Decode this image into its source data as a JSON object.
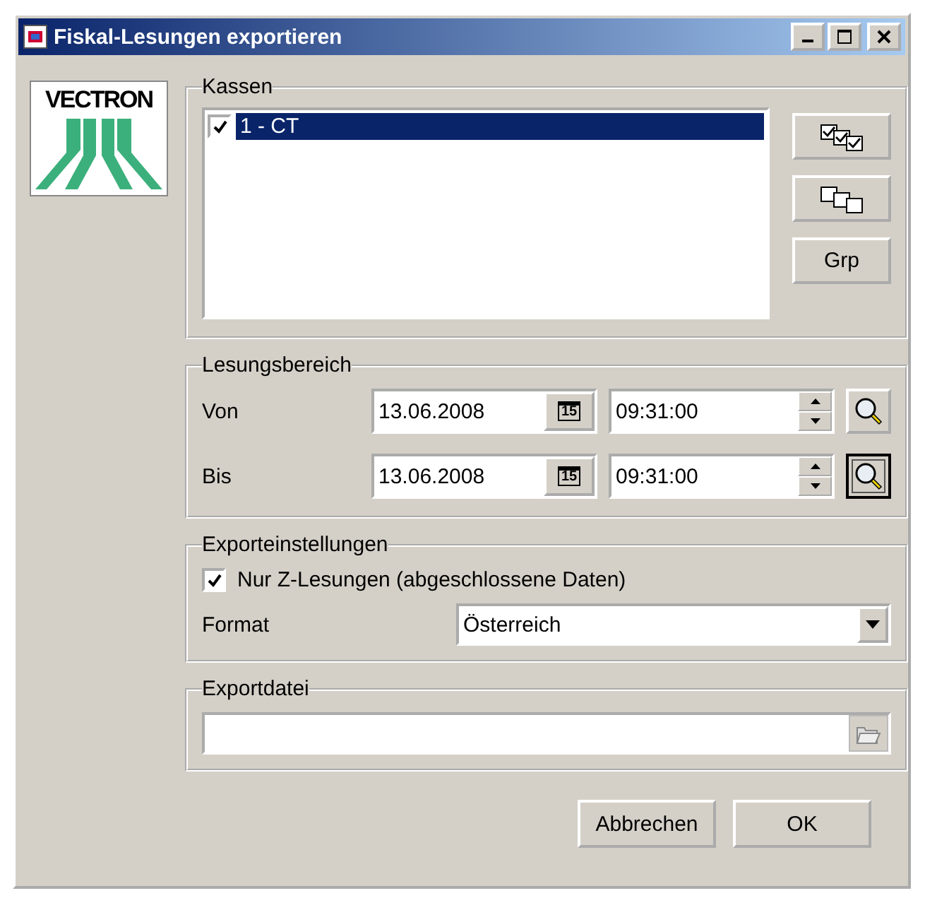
{
  "window": {
    "title": "Fiskal-Lesungen exportieren"
  },
  "logo": {
    "text": "VECTRON"
  },
  "kassen": {
    "label": "Kassen",
    "items": [
      {
        "label": "1 - CT",
        "checked": true,
        "selected": true
      }
    ],
    "buttons": [
      {
        "kind": "check-all"
      },
      {
        "kind": "uncheck-all"
      },
      {
        "kind": "text",
        "label": "Grp"
      }
    ]
  },
  "range": {
    "label": "Lesungsbereich",
    "rows": [
      {
        "label": "Von",
        "date": "13.06.2008",
        "calendar": "15",
        "time": "09:31:00",
        "focused": false
      },
      {
        "label": "Bis",
        "date": "13.06.2008",
        "calendar": "15",
        "time": "09:31:00",
        "focused": true
      }
    ]
  },
  "settings": {
    "label": "Exporteinstellungen",
    "only_z": {
      "label": "Nur Z-Lesungen (abgeschlossene Daten)",
      "checked": true
    },
    "format": {
      "label": "Format",
      "value": "Österreich"
    }
  },
  "export_file": {
    "label": "Exportdatei"
  },
  "buttons": [
    "Abbrechen",
    "OK"
  ]
}
